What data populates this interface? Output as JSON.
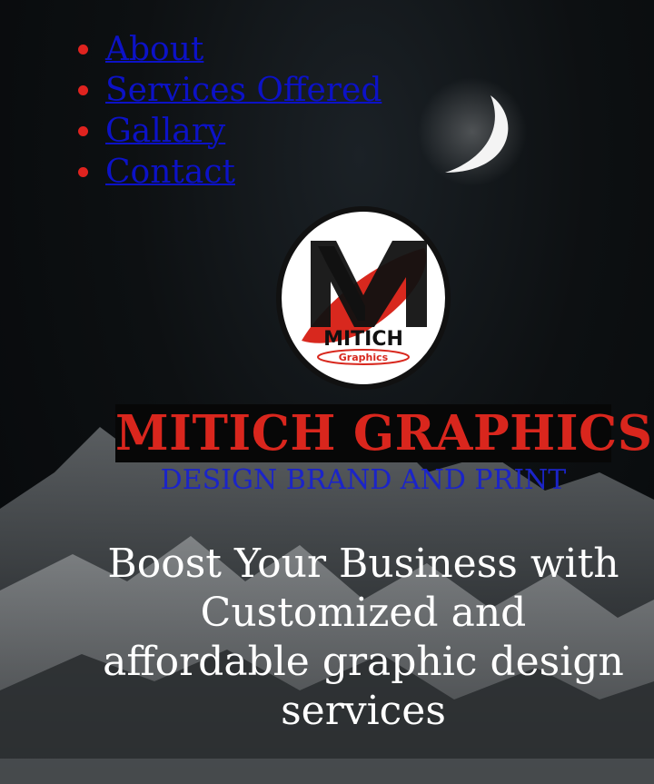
{
  "nav": {
    "items": [
      {
        "label": "About"
      },
      {
        "label": "Services Offered"
      },
      {
        "label": "Gallary"
      },
      {
        "label": "Contact"
      }
    ]
  },
  "logo": {
    "letter": "M",
    "wordmark": "MITICH",
    "subword": "Graphics"
  },
  "brand": {
    "title": "MITICH GRAPHICS",
    "tagline": "DESIGN BRAND AND PRINT"
  },
  "hero": {
    "headline": "Boost Your Business with Customized and affordable graphic design services"
  },
  "colors": {
    "link": "#0c12c7",
    "bullet": "#e0231f",
    "brand_red": "#d9261d",
    "tagline_blue": "#1b24c8",
    "hero_text": "#ffffff"
  }
}
